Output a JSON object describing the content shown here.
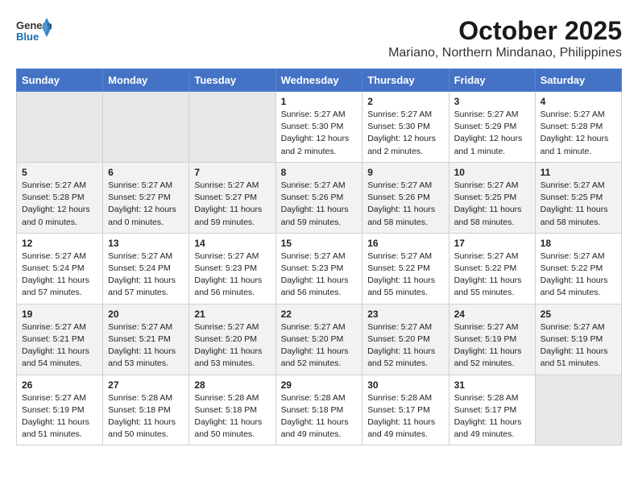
{
  "header": {
    "logo_general": "General",
    "logo_blue": "Blue",
    "month": "October 2025",
    "location": "Mariano, Northern Mindanao, Philippines"
  },
  "columns": [
    "Sunday",
    "Monday",
    "Tuesday",
    "Wednesday",
    "Thursday",
    "Friday",
    "Saturday"
  ],
  "weeks": [
    [
      {
        "day": "",
        "sunrise": "",
        "sunset": "",
        "daylight": ""
      },
      {
        "day": "",
        "sunrise": "",
        "sunset": "",
        "daylight": ""
      },
      {
        "day": "",
        "sunrise": "",
        "sunset": "",
        "daylight": ""
      },
      {
        "day": "1",
        "sunrise": "Sunrise: 5:27 AM",
        "sunset": "Sunset: 5:30 PM",
        "daylight": "Daylight: 12 hours and 2 minutes."
      },
      {
        "day": "2",
        "sunrise": "Sunrise: 5:27 AM",
        "sunset": "Sunset: 5:30 PM",
        "daylight": "Daylight: 12 hours and 2 minutes."
      },
      {
        "day": "3",
        "sunrise": "Sunrise: 5:27 AM",
        "sunset": "Sunset: 5:29 PM",
        "daylight": "Daylight: 12 hours and 1 minute."
      },
      {
        "day": "4",
        "sunrise": "Sunrise: 5:27 AM",
        "sunset": "Sunset: 5:28 PM",
        "daylight": "Daylight: 12 hours and 1 minute."
      }
    ],
    [
      {
        "day": "5",
        "sunrise": "Sunrise: 5:27 AM",
        "sunset": "Sunset: 5:28 PM",
        "daylight": "Daylight: 12 hours and 0 minutes."
      },
      {
        "day": "6",
        "sunrise": "Sunrise: 5:27 AM",
        "sunset": "Sunset: 5:27 PM",
        "daylight": "Daylight: 12 hours and 0 minutes."
      },
      {
        "day": "7",
        "sunrise": "Sunrise: 5:27 AM",
        "sunset": "Sunset: 5:27 PM",
        "daylight": "Daylight: 11 hours and 59 minutes."
      },
      {
        "day": "8",
        "sunrise": "Sunrise: 5:27 AM",
        "sunset": "Sunset: 5:26 PM",
        "daylight": "Daylight: 11 hours and 59 minutes."
      },
      {
        "day": "9",
        "sunrise": "Sunrise: 5:27 AM",
        "sunset": "Sunset: 5:26 PM",
        "daylight": "Daylight: 11 hours and 58 minutes."
      },
      {
        "day": "10",
        "sunrise": "Sunrise: 5:27 AM",
        "sunset": "Sunset: 5:25 PM",
        "daylight": "Daylight: 11 hours and 58 minutes."
      },
      {
        "day": "11",
        "sunrise": "Sunrise: 5:27 AM",
        "sunset": "Sunset: 5:25 PM",
        "daylight": "Daylight: 11 hours and 58 minutes."
      }
    ],
    [
      {
        "day": "12",
        "sunrise": "Sunrise: 5:27 AM",
        "sunset": "Sunset: 5:24 PM",
        "daylight": "Daylight: 11 hours and 57 minutes."
      },
      {
        "day": "13",
        "sunrise": "Sunrise: 5:27 AM",
        "sunset": "Sunset: 5:24 PM",
        "daylight": "Daylight: 11 hours and 57 minutes."
      },
      {
        "day": "14",
        "sunrise": "Sunrise: 5:27 AM",
        "sunset": "Sunset: 5:23 PM",
        "daylight": "Daylight: 11 hours and 56 minutes."
      },
      {
        "day": "15",
        "sunrise": "Sunrise: 5:27 AM",
        "sunset": "Sunset: 5:23 PM",
        "daylight": "Daylight: 11 hours and 56 minutes."
      },
      {
        "day": "16",
        "sunrise": "Sunrise: 5:27 AM",
        "sunset": "Sunset: 5:22 PM",
        "daylight": "Daylight: 11 hours and 55 minutes."
      },
      {
        "day": "17",
        "sunrise": "Sunrise: 5:27 AM",
        "sunset": "Sunset: 5:22 PM",
        "daylight": "Daylight: 11 hours and 55 minutes."
      },
      {
        "day": "18",
        "sunrise": "Sunrise: 5:27 AM",
        "sunset": "Sunset: 5:22 PM",
        "daylight": "Daylight: 11 hours and 54 minutes."
      }
    ],
    [
      {
        "day": "19",
        "sunrise": "Sunrise: 5:27 AM",
        "sunset": "Sunset: 5:21 PM",
        "daylight": "Daylight: 11 hours and 54 minutes."
      },
      {
        "day": "20",
        "sunrise": "Sunrise: 5:27 AM",
        "sunset": "Sunset: 5:21 PM",
        "daylight": "Daylight: 11 hours and 53 minutes."
      },
      {
        "day": "21",
        "sunrise": "Sunrise: 5:27 AM",
        "sunset": "Sunset: 5:20 PM",
        "daylight": "Daylight: 11 hours and 53 minutes."
      },
      {
        "day": "22",
        "sunrise": "Sunrise: 5:27 AM",
        "sunset": "Sunset: 5:20 PM",
        "daylight": "Daylight: 11 hours and 52 minutes."
      },
      {
        "day": "23",
        "sunrise": "Sunrise: 5:27 AM",
        "sunset": "Sunset: 5:20 PM",
        "daylight": "Daylight: 11 hours and 52 minutes."
      },
      {
        "day": "24",
        "sunrise": "Sunrise: 5:27 AM",
        "sunset": "Sunset: 5:19 PM",
        "daylight": "Daylight: 11 hours and 52 minutes."
      },
      {
        "day": "25",
        "sunrise": "Sunrise: 5:27 AM",
        "sunset": "Sunset: 5:19 PM",
        "daylight": "Daylight: 11 hours and 51 minutes."
      }
    ],
    [
      {
        "day": "26",
        "sunrise": "Sunrise: 5:27 AM",
        "sunset": "Sunset: 5:19 PM",
        "daylight": "Daylight: 11 hours and 51 minutes."
      },
      {
        "day": "27",
        "sunrise": "Sunrise: 5:28 AM",
        "sunset": "Sunset: 5:18 PM",
        "daylight": "Daylight: 11 hours and 50 minutes."
      },
      {
        "day": "28",
        "sunrise": "Sunrise: 5:28 AM",
        "sunset": "Sunset: 5:18 PM",
        "daylight": "Daylight: 11 hours and 50 minutes."
      },
      {
        "day": "29",
        "sunrise": "Sunrise: 5:28 AM",
        "sunset": "Sunset: 5:18 PM",
        "daylight": "Daylight: 11 hours and 49 minutes."
      },
      {
        "day": "30",
        "sunrise": "Sunrise: 5:28 AM",
        "sunset": "Sunset: 5:17 PM",
        "daylight": "Daylight: 11 hours and 49 minutes."
      },
      {
        "day": "31",
        "sunrise": "Sunrise: 5:28 AM",
        "sunset": "Sunset: 5:17 PM",
        "daylight": "Daylight: 11 hours and 49 minutes."
      },
      {
        "day": "",
        "sunrise": "",
        "sunset": "",
        "daylight": ""
      }
    ]
  ]
}
